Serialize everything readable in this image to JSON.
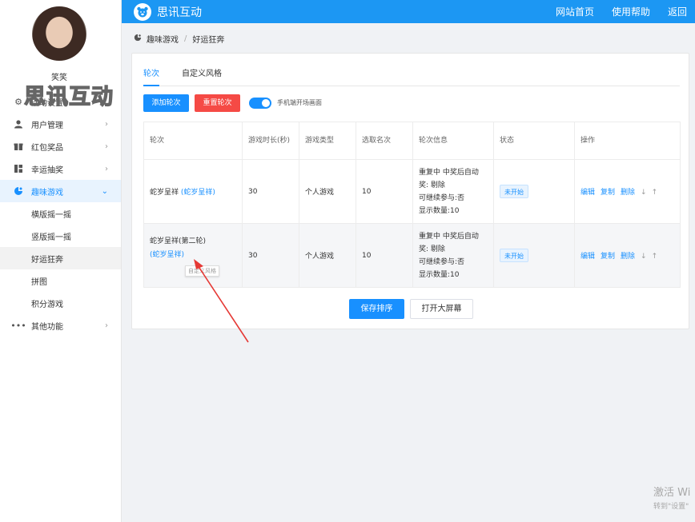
{
  "app": {
    "brand": "思讯互动",
    "logo_icon": "bear-face-icon",
    "accent": "#1c97f3"
  },
  "topnav": {
    "links": [
      "网站首页",
      "使用帮助",
      "返回"
    ]
  },
  "sidebar": {
    "username": "笑笑",
    "watermark": "思讯互动",
    "items": [
      {
        "label": "活动设置",
        "icon": "gear-icon"
      },
      {
        "label": "用户管理",
        "icon": "user-icon"
      },
      {
        "label": "红包奖品",
        "icon": "gift-icon"
      },
      {
        "label": "幸运抽奖",
        "icon": "grid-icon"
      },
      {
        "label": "趣味游戏",
        "icon": "gamepad-icon"
      },
      {
        "label": "其他功能",
        "icon": "more-icon"
      }
    ],
    "subitems": [
      "横版摇一摇",
      "竖版摇一摇",
      "好运狂奔",
      "拼图",
      "积分游戏"
    ]
  },
  "breadcrumb": {
    "items": [
      "趣味游戏",
      "好运狂奔"
    ],
    "separator": "/"
  },
  "tabs": [
    "轮次",
    "自定义风格"
  ],
  "toolbar": {
    "add_label": "添加轮次",
    "reset_label": "重置轮次",
    "switch_label": "手机端开场画面",
    "switch_on": true
  },
  "table": {
    "headers": [
      "轮次",
      "游戏时长(秒)",
      "游戏类型",
      "选取名次",
      "轮次信息",
      "状态",
      "操作"
    ],
    "rows": [
      {
        "name": "蛇岁呈祥",
        "link": "(蛇岁呈祥)",
        "duration": "30",
        "type": "个人游戏",
        "rank": "10",
        "info": [
          "重复中  中奖后自动",
          "奖:      剔除",
          "可继续参与:否",
          "显示数量:10"
        ],
        "status": "未开始"
      },
      {
        "name": "蛇岁呈祥(第二轮)",
        "link": "(蛇岁呈祥)",
        "duration": "30",
        "type": "个人游戏",
        "rank": "10",
        "info": [
          "重复中  中奖后自动",
          "奖:      剔除",
          "可继续参与:否",
          "显示数量:10"
        ],
        "status": "未开始"
      }
    ],
    "ops": [
      "编辑",
      "复制",
      "删除",
      "↓",
      "↑"
    ],
    "tooltip": "自定义风格"
  },
  "footer_buttons": {
    "save": "保存排序",
    "open": "打开大屏幕"
  },
  "os_watermark": {
    "line1": "激活 Wi",
    "line2": "转到\"设置\""
  },
  "annotation": {
    "arrow_color": "#e53935"
  }
}
